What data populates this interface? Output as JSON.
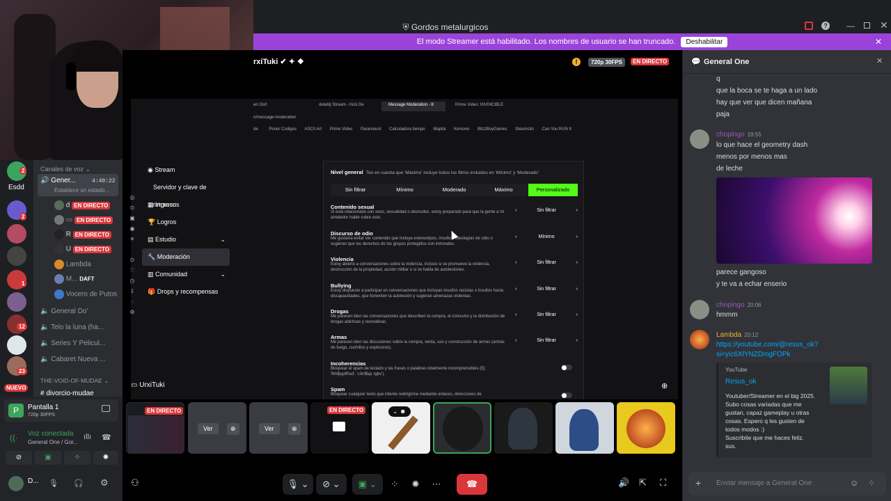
{
  "window": {
    "title": "Gordos metalurgicos"
  },
  "banner": {
    "text": "El modo Streamer está habilitado. Los nombres de usuario se han truncado.",
    "button": "Deshabilitar"
  },
  "stream": {
    "streamer": "rxiTuki",
    "quality": "720p 30FPS",
    "live": "EN DIRECTO",
    "owner_label": "UrxiTuki"
  },
  "browser": {
    "tabs": [
      "en Oo0",
      "deletdj Stream - Kick De",
      "Message Moderation - K",
      "Prime Video: INVINCIBLE"
    ],
    "url": "n/message-moderation",
    "bookmarks": [
      "de",
      "Poner Codigos",
      "ASCII Art",
      "Prime Video",
      "Paramount",
      "Calculadora tiempo",
      "Mapita",
      "Kemono",
      "BlizzBoyGames",
      "Steamcito",
      "Can You RUN It"
    ]
  },
  "settings_nav": [
    {
      "label": "Stream",
      "icon": "broadcast-icon"
    },
    {
      "label": "Servidor y clave de retransn",
      "icon": ""
    },
    {
      "label": "Ingresos",
      "icon": "revenue-icon"
    },
    {
      "label": "Logros",
      "icon": "trophy-icon"
    },
    {
      "label": "Estudio",
      "icon": "studio-icon",
      "chevron": "⌄"
    },
    {
      "label": "Moderación",
      "icon": "wrench-icon"
    },
    {
      "label": "Comunidad",
      "icon": "community-icon",
      "chevron": "⌄"
    },
    {
      "label": "Drops y recompensas",
      "icon": "gift-icon"
    }
  ],
  "moderation": {
    "level_title": "Nivel general",
    "level_note": "Ten en cuenta que 'Máximo' incluye todos los filtros incluidos en 'Mínimo' y 'Moderado'",
    "levels": [
      "Sin filtrar",
      "Mínimo",
      "Moderado",
      "Máximo",
      "Personalizado"
    ],
    "rows": [
      {
        "title": "Contenido sexual",
        "desc": "Si está relacionado con sexo, sexualidad o desnudez, estoy preparado para que la gente a mi alrededor hable sobre esto.",
        "value": "Sin filtrar"
      },
      {
        "title": "Discurso de odio",
        "desc": "Me gustaría evitar ver contenido que incluya estereotipos, insultos, ideologías de odio o sugieran que los derechos de los grupos protegidos son inmorales.",
        "value": "Mínimo"
      },
      {
        "title": "Violencia",
        "desc": "Estoy abierto a conversaciones sobre la violencia, incluso si se promueve la violencia, destrucción de la propiedad, acción militar o si se habla de autolesiones.",
        "value": "Sin filtrar"
      },
      {
        "title": "Bullying",
        "desc": "Estoy dispuesto a participar en conversaciones que incluyan insultos racistas o insultos hacia discapacidades, que fomenten la autolesión y sugieran amenazas violentas.",
        "value": "Sin filtrar"
      },
      {
        "title": "Drogas",
        "desc": "Me parecen bien las conversaciones que describen la compra, el consumo y la distribución de drogas adictivas y recreativas.",
        "value": "Sin filtrar"
      },
      {
        "title": "Armas",
        "desc": "Me parecen bien las discusiones sobre la compra, venta, uso y construcción de armas (armas de fuego, cuchillos y explosivos).",
        "value": "Sin filtrar"
      }
    ],
    "toggles": [
      {
        "title": "Incoherencias",
        "desc": "Bloquear el spam de teclado y las frases o palabras totalmente incomprensibles (Ej: 'fkhfjkgdfhsd', 'c3nf$qc rgbv')."
      },
      {
        "title": "Spam",
        "desc": "Bloquear cualquier texto que intente redirigirme mediante enlaces, direcciones de"
      }
    ]
  },
  "sidebar": {
    "voice_header": "Canales de voz",
    "active_channel": "Gener...",
    "active_time": "4:40:22",
    "active_sub": "Establece un estado...",
    "members": [
      {
        "name": "d",
        "live": "EN DIRECTO"
      },
      {
        "name": "",
        "live": "EN DIRECTO"
      },
      {
        "name": "R",
        "live": "EN DIRECTO"
      },
      {
        "name": "U",
        "live": "EN DIRECTO"
      },
      {
        "name": "Lambda",
        "live": ""
      },
      {
        "name": "M...",
        "live": "",
        "tag": "DAFT"
      },
      {
        "name": "Vocero de Putos",
        "live": ""
      }
    ],
    "channels": [
      "General Do'",
      "Telo la luna (ha...",
      "Series Y Pelicul...",
      "Cabaret Nueva ..."
    ],
    "category": "THE-VOID-OF-MUDAE",
    "text_channel": "divorcio-mudae",
    "new_badge": "NUEVO",
    "server_label": "Esdd",
    "badges": [
      "2",
      "2",
      "1",
      "12",
      "23"
    ]
  },
  "voice": {
    "screen_title": "Pantalla 1",
    "screen_sub": "720p 30FPS",
    "connected": "Voz conectada",
    "connected_sub": "General One / Gor...",
    "user": "D..."
  },
  "tiles": {
    "live": "EN DIRECTO",
    "watch": "Ver"
  },
  "chat": {
    "channel": "General One",
    "lines_top": [
      "q",
      "que la boca se te haga a un lado",
      "hay que ver que dicen mañana",
      "paja"
    ],
    "messages": [
      {
        "user": "chopingo",
        "time": "19:55",
        "lines": [
          "lo que hace el geometry dash",
          "menos por menos mas",
          "de leche"
        ]
      },
      {
        "user": "",
        "time": "",
        "lines": [
          "parece gangoso",
          "y te va a echar enserio"
        ]
      },
      {
        "user": "chopingo",
        "time": "20:06",
        "lines": [
          "hmmm"
        ]
      },
      {
        "user": "Lambda",
        "time": "20:12",
        "lines": [
          "https://youtube.com/@resus_ok?",
          "si=yic6XlYNZDmgFOPk"
        ]
      }
    ],
    "embed": {
      "provider": "YouTube",
      "title": "Resus_ok",
      "desc": [
        "Youtuber/Streamer en el big 2025.",
        "Subo cosas variadas que me",
        "gustan, capaz gameplay u otras",
        "cosas. Espero q les gusten de",
        "todos modos :)",
        "Suscribite que me haces feliz.",
        "sus."
      ]
    },
    "input_placeholder": "Enviar mensaje a General One"
  },
  "colors": {
    "accent": "#5865f2",
    "live": "#da373c",
    "kick": "#53fc18",
    "banner": "#9b43d8"
  }
}
